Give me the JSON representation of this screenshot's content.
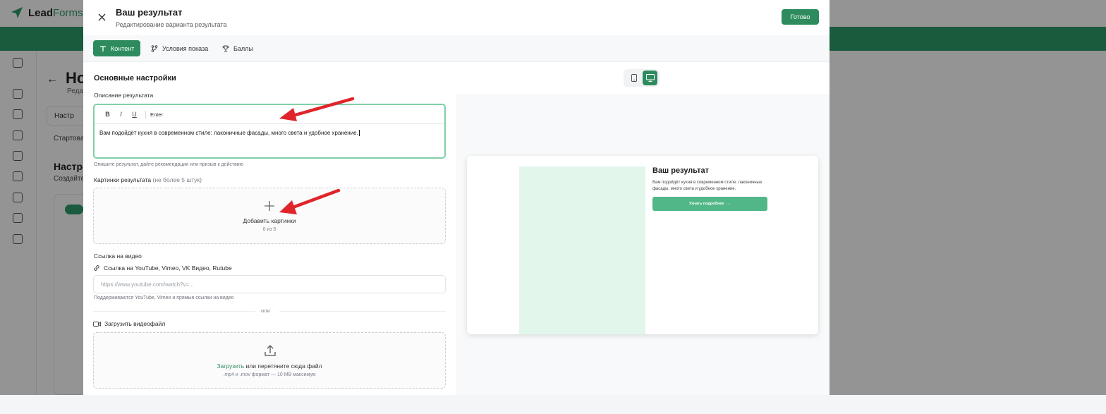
{
  "background_app": {
    "logo_lead": "Lead",
    "logo_forms": "Forms",
    "page_title_partial": "Но",
    "page_sub_partial": "Реда",
    "tab_partial": "Настр",
    "start_partial": "Стартова",
    "section_partial": "Настро",
    "create_partial": "Создайте"
  },
  "modal": {
    "title": "Ваш результат",
    "subtitle": "Редактирование варианта результата",
    "done_label": "Готово",
    "close_icon": "close-icon"
  },
  "tabs": [
    {
      "label": "Контент",
      "icon": "text-icon",
      "active": true
    },
    {
      "label": "Условия показа",
      "icon": "branch-icon",
      "active": false
    },
    {
      "label": "Баллы",
      "icon": "trophy-icon",
      "active": false
    }
  ],
  "form": {
    "section_title": "Основные настройки",
    "description": {
      "label": "Описание результата",
      "toolbar": {
        "bold": "B",
        "italic": "I",
        "underline": "U",
        "enter": "Enter"
      },
      "text": "Вам подойдёт кухня в современном стиле: лаконичные фасады, много света и удобное хранение.",
      "hint": "Опишите результат, дайте рекомендации или призыв к действию"
    },
    "images": {
      "label": "Картинки результата",
      "label_muted": "(не более 5 штук)",
      "add_label": "Добавить картинки",
      "count": "0 из 5"
    },
    "video": {
      "label": "Ссылка на видео",
      "link_label": "Ссылка на YouTube, Vimeo, VK Видео, Rutube",
      "placeholder": "https://www.youtube.com/watch?v=...",
      "hint": "Поддерживаются YouTube, Vimeo и прямые ссылки на видео",
      "or": "или",
      "upload_label": "Загрузить видеофайл",
      "upload_link": "Загрузить",
      "upload_rest": " или перетяните сюда файл",
      "upload_formats": ".mp4 и .mov формат — 10 MB максимум"
    }
  },
  "preview": {
    "title": "Ваш результат",
    "description": "Вам подойдёт кухня в современном стиле: лаконичные фасады, много света и удобное хранение.",
    "button_label": "Узнать подробнее",
    "button_arrow": "→",
    "active_device": "desktop"
  },
  "colors": {
    "accent": "#2e8b5e",
    "preview_button": "#52b788",
    "preview_image": "#e2f6ec",
    "annotation": "#e0252a"
  }
}
